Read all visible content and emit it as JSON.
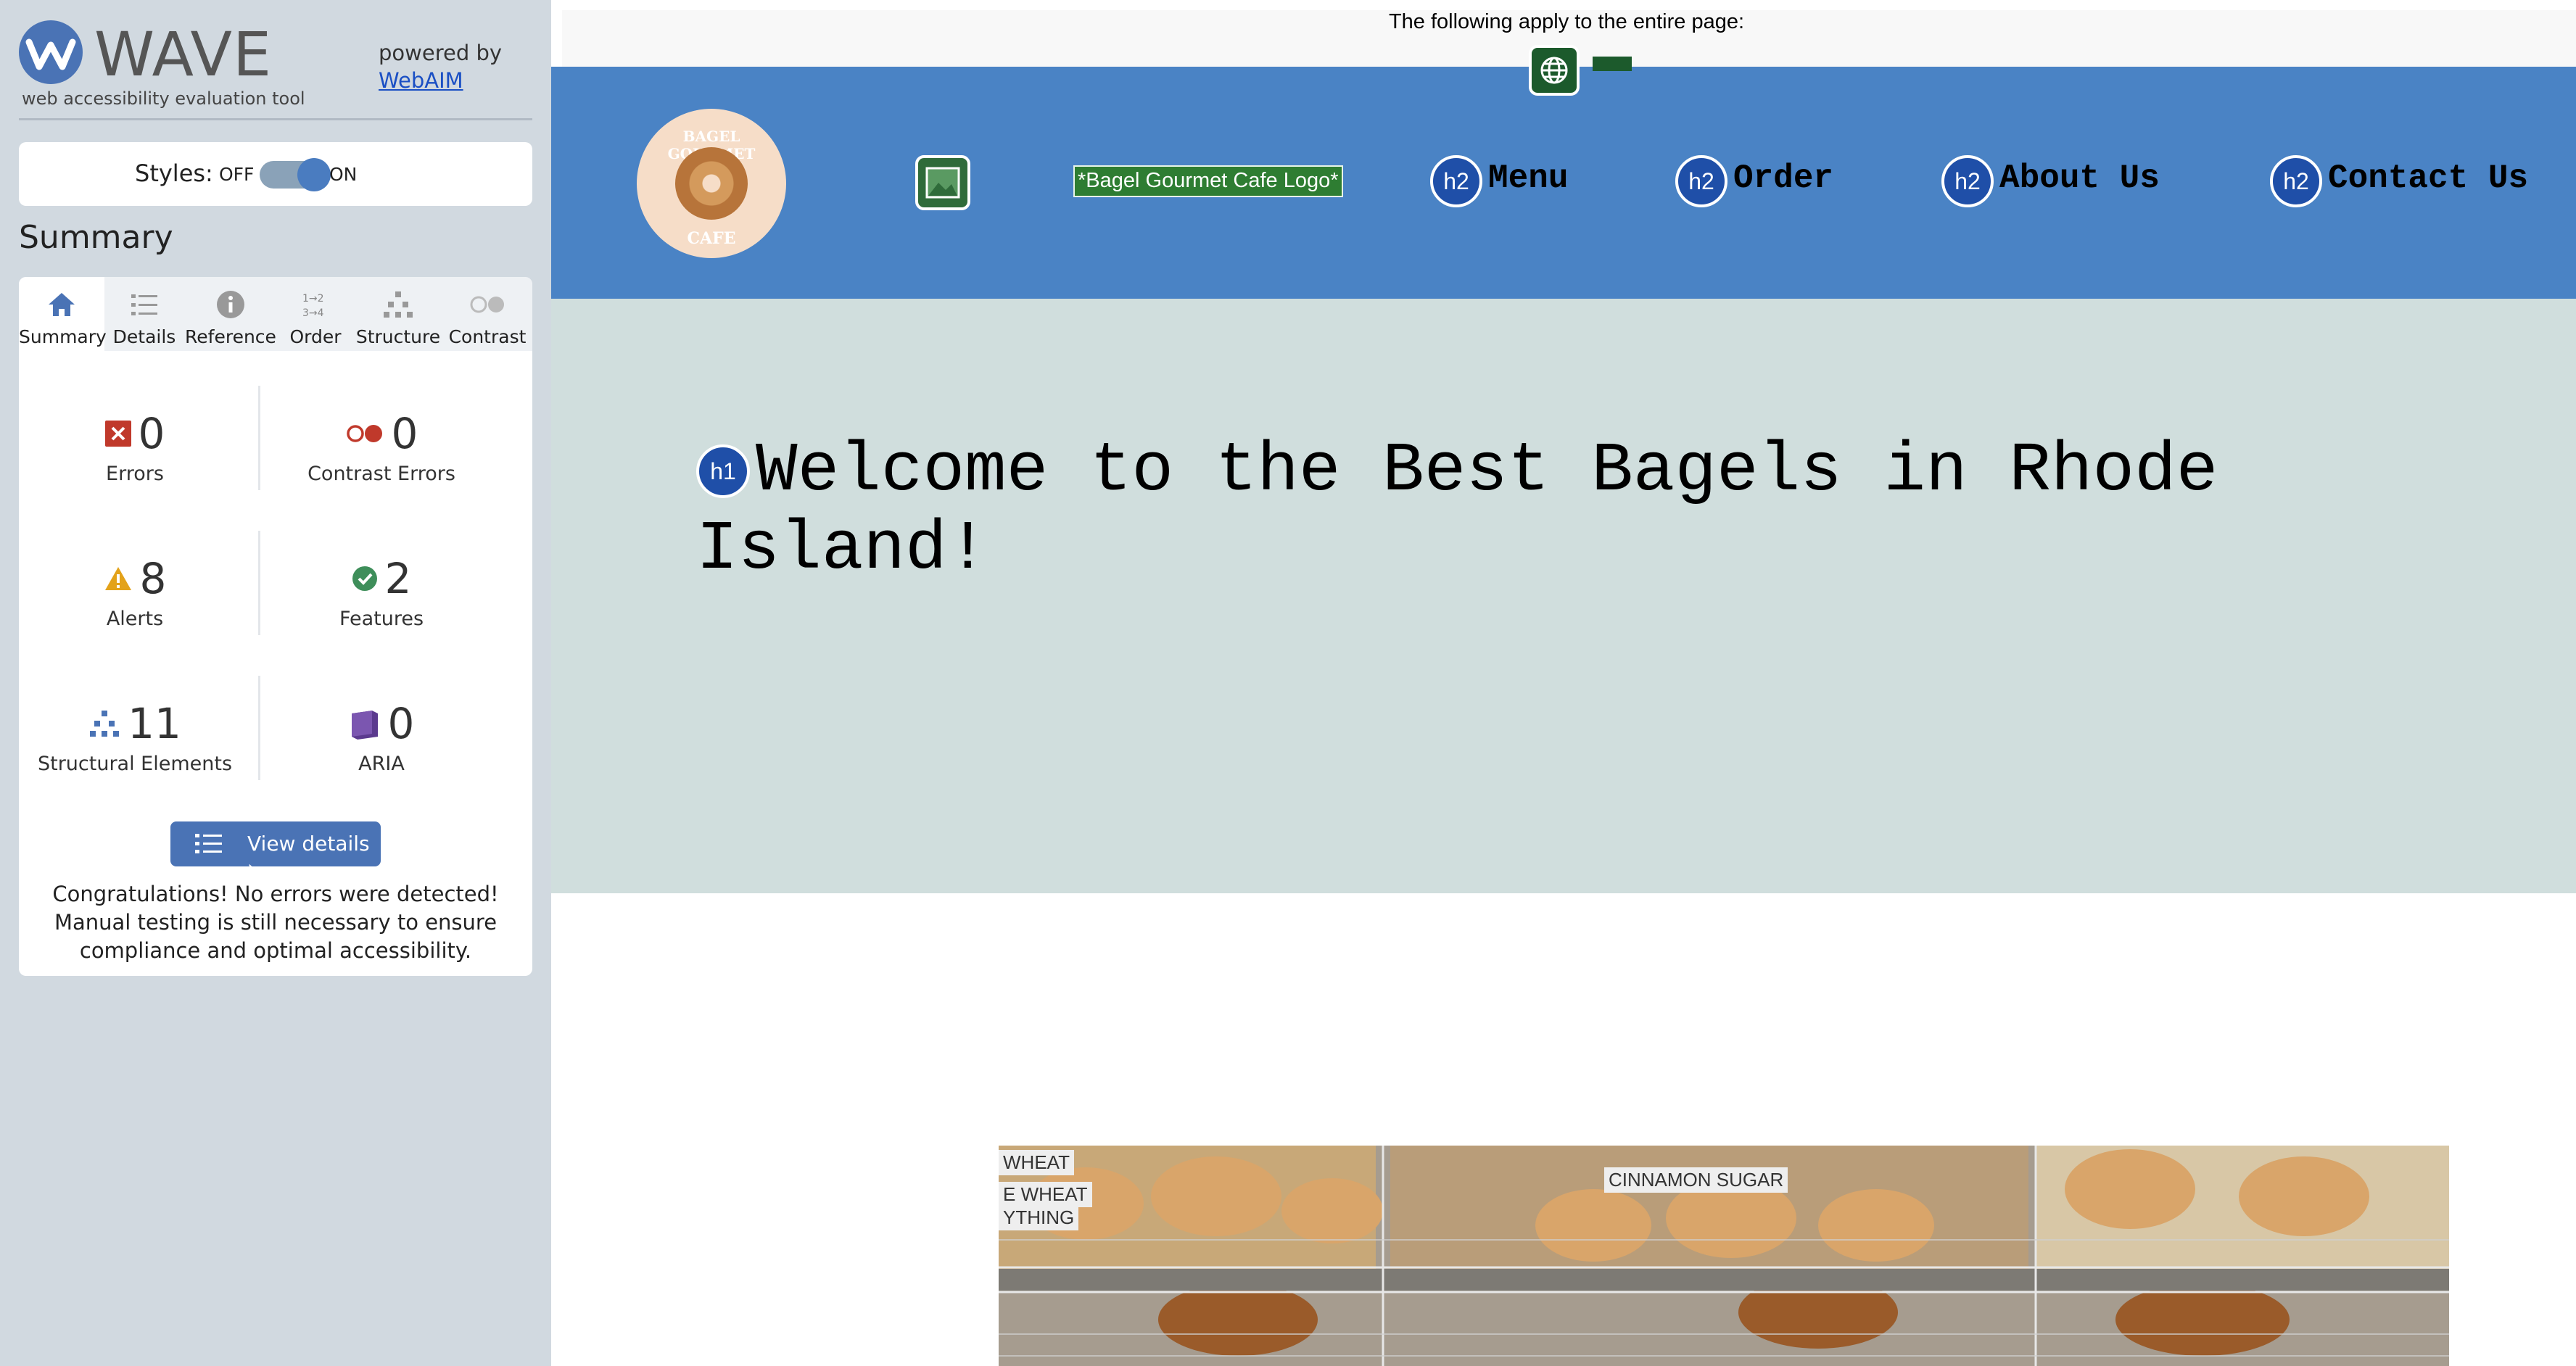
{
  "wave": {
    "brand": "WAVE",
    "tagline": "web accessibility evaluation tool",
    "powered_by": "powered by",
    "webaim_link": "WebAIM",
    "styles_label": "Styles:",
    "styles_off": "OFF",
    "styles_on": "ON",
    "styles_enabled": true,
    "summary_heading": "Summary",
    "tabs": [
      {
        "label": "Summary",
        "icon": "home-icon",
        "active": true
      },
      {
        "label": "Details",
        "icon": "list-icon",
        "active": false
      },
      {
        "label": "Reference",
        "icon": "info-icon",
        "active": false
      },
      {
        "label": "Order",
        "icon": "order-icon",
        "active": false
      },
      {
        "label": "Structure",
        "icon": "structure-icon",
        "active": false
      },
      {
        "label": "Contrast",
        "icon": "contrast-icon",
        "active": false
      }
    ],
    "stats": {
      "errors": {
        "value": "0",
        "label": "Errors",
        "icon": "error-icon",
        "color": "#c0392b"
      },
      "contrast_errors": {
        "value": "0",
        "label": "Contrast Errors",
        "icon": "contrast-error-icon",
        "color": "#c0392b"
      },
      "alerts": {
        "value": "8",
        "label": "Alerts",
        "icon": "alert-icon",
        "color": "#e3a21a"
      },
      "features": {
        "value": "2",
        "label": "Features",
        "icon": "feature-icon",
        "color": "#3e8e5a"
      },
      "structural": {
        "value": "11",
        "label": "Structural Elements",
        "icon": "structure-icon",
        "color": "#4a73b5"
      },
      "aria": {
        "value": "0",
        "label": "ARIA",
        "icon": "aria-icon",
        "color": "#5b3a8e"
      }
    },
    "view_details": "View details ›",
    "congrats": "Congratulations! No errors were detected! Manual testing is still necessary to ensure compliance and optimal accessibility."
  },
  "page": {
    "top_notice": "The following apply to the entire page:",
    "logo_text_top": "BAGEL GOURMET",
    "logo_text_bottom": "CAFE",
    "logo_alt": "*Bagel Gourmet Cafe Logo*",
    "nav": [
      {
        "tag": "h2",
        "label": "Menu"
      },
      {
        "tag": "h2",
        "label": "Order"
      },
      {
        "tag": "h2",
        "label": "About Us"
      },
      {
        "tag": "h2",
        "label": "Contact Us"
      }
    ],
    "h1_tag": "h1",
    "heading": "Welcome to the Best Bagels in Rhode Island!",
    "photo_signs": [
      "WHEAT",
      "E WHEAT",
      "YTHING",
      "CINNAMON SUGAR"
    ],
    "colors": {
      "nav_bg": "#4a83c5",
      "hero_bg": "#d0dedd",
      "wave_bg": "#d1d9e0",
      "heading_icon": "#1f4fa8",
      "feature_green": "#2e7d32"
    }
  }
}
